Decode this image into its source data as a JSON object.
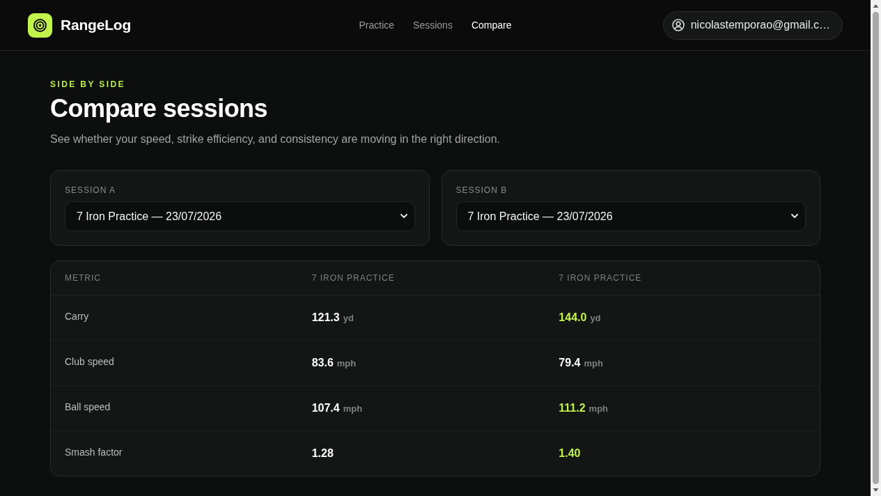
{
  "app": {
    "name": "RangeLog"
  },
  "nav": [
    {
      "label": "Practice",
      "selected": false
    },
    {
      "label": "Sessions",
      "selected": false
    },
    {
      "label": "Compare",
      "selected": true
    }
  ],
  "account": {
    "email": "nicolastemporao@gmail.c…"
  },
  "page": {
    "eyebrow": "SIDE BY SIDE",
    "title": "Compare sessions",
    "subtitle": "See whether your speed, strike efficiency, and consistency are moving in the right direction."
  },
  "selectors": [
    {
      "label": "SESSION A",
      "value": "7 Iron Practice — 23/07/2026"
    },
    {
      "label": "SESSION B",
      "value": "7 Iron Practice — 23/07/2026"
    }
  ],
  "table": {
    "columns": [
      "METRIC",
      "7 IRON PRACTICE",
      "7 IRON PRACTICE"
    ],
    "rows": [
      {
        "metric": "Carry",
        "values": [
          {
            "value": "121.3",
            "unit": "yd",
            "better": false
          },
          {
            "value": "144.0",
            "unit": "yd",
            "better": true
          }
        ]
      },
      {
        "metric": "Club speed",
        "values": [
          {
            "value": "83.6",
            "unit": "mph",
            "better": false
          },
          {
            "value": "79.4",
            "unit": "mph",
            "better": false
          }
        ]
      },
      {
        "metric": "Ball speed",
        "values": [
          {
            "value": "107.4",
            "unit": "mph",
            "better": false
          },
          {
            "value": "111.2",
            "unit": "mph",
            "better": true
          }
        ]
      },
      {
        "metric": "Smash factor",
        "values": [
          {
            "value": "1.28",
            "better": false
          },
          {
            "value": "1.40",
            "better": true
          }
        ]
      }
    ]
  }
}
